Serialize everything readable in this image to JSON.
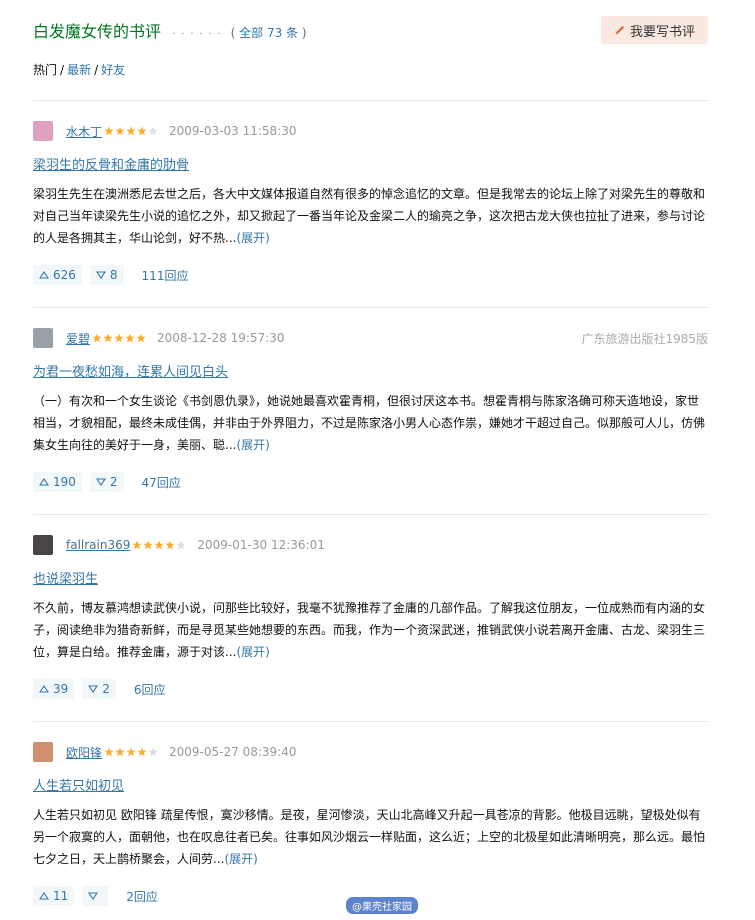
{
  "header": {
    "title": "白发魔女传的书评",
    "dots": "· · · · · ·",
    "count_open": "( ",
    "count_link": "全部 73 条",
    "count_close": " )",
    "write_button": "我要写书评"
  },
  "sorts": {
    "hot": "热门",
    "sep1": "/",
    "latest": "最新",
    "sep2": "/",
    "friends": "好友"
  },
  "reviews": [
    {
      "user": "水木丁",
      "rating": 4,
      "time": "2009-03-03 11:58:30",
      "edition": "",
      "title": "梁羽生的反骨和金庸的肋骨",
      "content": "梁羽生先生在澳洲悉尼去世之后，各大中文媒体报道自然有很多的悼念追忆的文章。但是我常去的论坛上除了对梁先生的尊敬和对自己当年读梁先生小说的追忆之外，却又掀起了一番当年论及金梁二人的瑜亮之争，这次把古龙大侠也拉扯了进来，参与讨论的人是各拥其主，华山论剑，好不热...",
      "expand": "(展开)",
      "up": "626",
      "down": "8",
      "replies": "111回应",
      "avatar_color": "#e0a0c0"
    },
    {
      "user": "爱碧",
      "rating": 5,
      "time": "2008-12-28 19:57:30",
      "edition": "广东旅游出版社1985版",
      "title": "为君一夜愁如海，连累人间见白头",
      "content": "（一）有次和一个女生谈论《书剑恩仇录》，她说她最喜欢霍青桐，但很讨厌这本书。想霍青桐与陈家洛确可称天造地设，家世相当，才貌相配，最终未成佳偶，并非由于外界阻力，不过是陈家洛小男人心态作祟，嫌她才干超过自己。似那般可人儿，仿佛集女生向往的美好于一身，美丽、聪...",
      "expand": "(展开)",
      "up": "190",
      "down": "2",
      "replies": "47回应",
      "avatar_color": "#9aa0a8"
    },
    {
      "user": "fallrain369",
      "rating": 4,
      "time": "2009-01-30 12:36:01",
      "edition": "",
      "title": "也说梁羽生",
      "content": "不久前，博友慕鸿想读武侠小说，问那些比较好，我毫不犹豫推荐了金庸的几部作品。了解我这位朋友，一位成熟而有内涵的女子，阅读绝非为猎奇新鲜，而是寻觅某些她想要的东西。而我，作为一个资深武迷，推销武侠小说若离开金庸、古龙、梁羽生三位，算是白给。推荐金庸，源于对该...",
      "expand": "(展开)",
      "up": "39",
      "down": "2",
      "replies": "6回应",
      "avatar_color": "#4a4448"
    },
    {
      "user": "欧阳锋",
      "rating": 4,
      "time": "2009-05-27 08:39:40",
      "edition": "",
      "title": "人生若只如初见",
      "content": "人生若只如初见 欧阳锋 疏星传恨，寞沙移情。是夜，星河惨淡，天山北高峰又升起一具苍凉的背影。他极目远眺，望极处似有另一个寂寞的人，面朝他，也在叹息往者已矣。往事如风沙烟云一样贴面，这么近；上空的北极星如此清晰明亮，那么远。最怕七夕之日，天上鹊桥聚会，人间劳...",
      "expand": "(展开)",
      "up": "11",
      "down": "",
      "replies": "2回应",
      "avatar_color": "#d09070"
    }
  ],
  "watermark": "@果壳社家园",
  "colors": {
    "title_green": "#007722",
    "link_blue": "#3377aa",
    "star": "#ffac2d",
    "button_bg": "#fae9e1"
  }
}
